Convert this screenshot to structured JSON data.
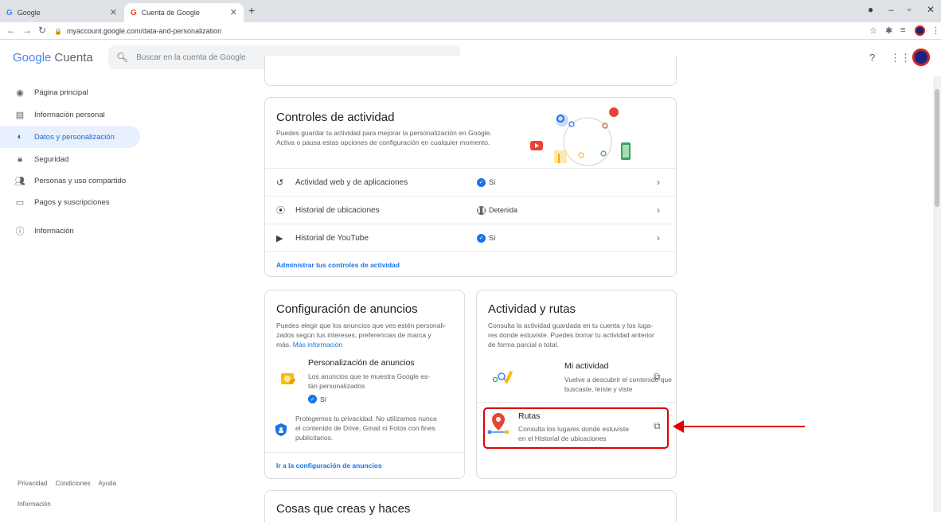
{
  "browser": {
    "tabs": [
      {
        "favicon": "G",
        "title": "Google"
      },
      {
        "favicon": "G",
        "title": "Cuenta de Google"
      }
    ],
    "url": "myaccount.google.com/data-and-personalization"
  },
  "header": {
    "logo_google": "Google",
    "logo_cuenta": "Cuenta",
    "search_placeholder": "Buscar en la cuenta de Google"
  },
  "sidebar": {
    "items": [
      {
        "label": "Página principal",
        "icon": "home-icon"
      },
      {
        "label": "Información personal",
        "icon": "id-card-icon"
      },
      {
        "label": "Datos y personalización",
        "icon": "toggle-icon"
      },
      {
        "label": "Seguridad",
        "icon": "lock-icon"
      },
      {
        "label": "Personas y uso compartido",
        "icon": "people-icon"
      },
      {
        "label": "Pagos y suscripciones",
        "icon": "credit-card-icon"
      },
      {
        "label": "Información",
        "icon": "info-icon"
      }
    ],
    "footer": {
      "privacy": "Privacidad",
      "terms": "Condiciones",
      "help": "Ayuda",
      "info": "Información"
    }
  },
  "activity_controls": {
    "title": "Controles de actividad",
    "desc1": "Puedes guardar tu actividad para mejorar la personalización en Google.",
    "desc2": "Activa o pausa estas opciones de configuración en cualquier momento.",
    "rows": [
      {
        "label": "Actividad web y de aplicaciones",
        "status": "Sí"
      },
      {
        "label": "Historial de ubicaciones",
        "status": "Detenida"
      },
      {
        "label": "Historial de YouTube",
        "status": "Sí"
      }
    ],
    "manage_link": "Administrar tus controles de actividad"
  },
  "ads": {
    "title": "Configuración de anuncios",
    "desc1": "Puedes elegir que los anuncios que ves estén personali-",
    "desc2": "zados según tus intereses, preferencias de marca y",
    "desc3": "más.",
    "more_info": "Más información",
    "personalization_title": "Personalización de anuncios",
    "personalization_desc1": "Los anuncios que te muestra Google es-",
    "personalization_desc2": "tán personalizados",
    "personalization_status": "Sí",
    "privacy1": "Protegemos tu privacidad. No utilizamos nunca",
    "privacy2": "el contenido de Drive, Gmail ni Fotos con fines",
    "privacy3": "publicitarios.",
    "settings_link": "Ir a la configuración de anuncios"
  },
  "activity_routes": {
    "title": "Actividad y rutas",
    "desc1": "Consulta la actividad guardada en tu cuenta y los luga-",
    "desc2": "res donde estuviste. Puedes borrar tu actividad anterior",
    "desc3": "de forma parcial o total.",
    "my_activity_title": "Mi actividad",
    "my_activity_desc1": "Vuelve a descubrir el contenido que",
    "my_activity_desc2": "buscaste, leíste y viste",
    "routes_title": "Rutas",
    "routes_desc1": "Consulta los lugares donde estuviste",
    "routes_desc2": "en el Historial de ubicaciones"
  },
  "things_you_create": {
    "title": "Cosas que creas y haces"
  },
  "colors": {
    "accent": "#1a73e8",
    "highlight": "#e00000",
    "active_bg": "#e8f0fe"
  }
}
